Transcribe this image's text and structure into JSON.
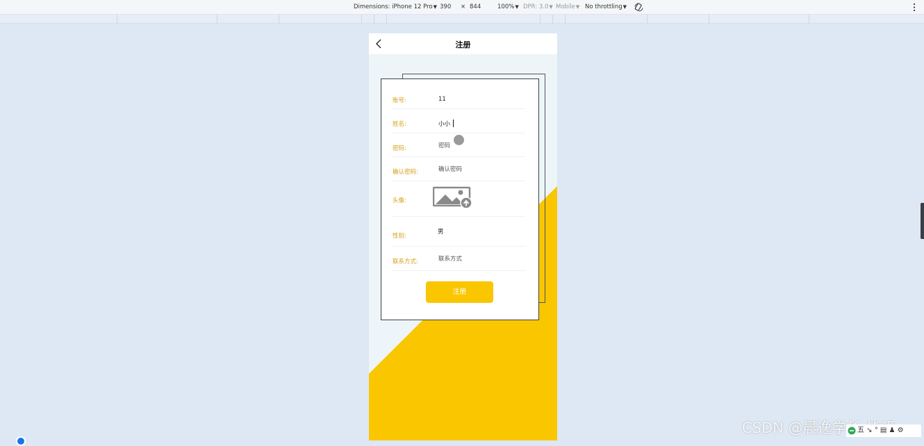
{
  "devtools": {
    "dimensions_label": "Dimensions: iPhone 12 Pro",
    "width": "390",
    "times": "×",
    "height": "844",
    "zoom": "100%",
    "dpr": "DPR: 3.0",
    "mobile": "Mobile",
    "throttling": "No throttling"
  },
  "navbar": {
    "title": "注册"
  },
  "form": {
    "account": {
      "label": "账号:",
      "value": "11"
    },
    "name": {
      "label": "姓名:",
      "value": "小小"
    },
    "password": {
      "label": "密码:",
      "placeholder": "密码"
    },
    "confirm_password": {
      "label": "确认密码:",
      "placeholder": "确认密码"
    },
    "avatar": {
      "label": "头像:"
    },
    "gender": {
      "label": "性别:",
      "value": "男"
    },
    "contact": {
      "label": "联系方式:",
      "placeholder": "联系方式"
    },
    "submit_label": "注册"
  },
  "colors": {
    "accent": "#f9c600",
    "label": "#d7a11a",
    "background": "#eef5f8"
  },
  "overlay": {
    "watermark": "CSDN @晨逸学长-毕设",
    "tray_text": "五 ↘ ° ▤ ♟ ⚙"
  }
}
